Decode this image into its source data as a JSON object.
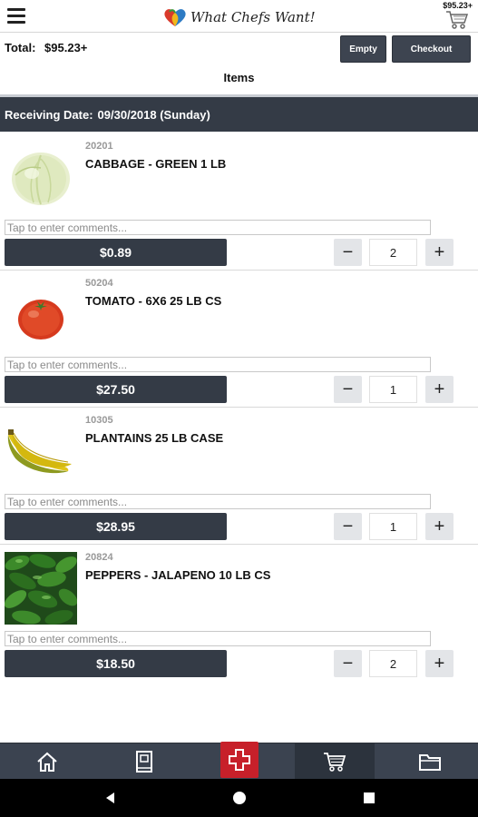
{
  "header": {
    "brand": "What Chefs Want!",
    "cart_amount": "$95.23+"
  },
  "summary": {
    "total_label": "Total:",
    "total_value": "$95.23+",
    "empty_label": "Empty",
    "checkout_label": "Checkout"
  },
  "section_title": "Items",
  "receiving": {
    "label": "Receiving Date:",
    "date": "09/30/2018 (Sunday)"
  },
  "comment_placeholder": "Tap to enter comments...",
  "items": [
    {
      "code": "20201",
      "name": "CABBAGE - GREEN 1 LB",
      "price": "$0.89",
      "qty": "2",
      "image": "cabbage-image"
    },
    {
      "code": "50204",
      "name": "TOMATO - 6X6 25 LB CS",
      "price": "$27.50",
      "qty": "1",
      "image": "tomato-image"
    },
    {
      "code": "10305",
      "name": "PLANTAINS 25 LB CASE",
      "price": "$28.95",
      "qty": "1",
      "image": "plantains-image"
    },
    {
      "code": "20824",
      "name": "PEPPERS - JALAPENO 10 LB CS",
      "price": "$18.50",
      "qty": "2",
      "image": "jalapeno-peppers-image"
    }
  ],
  "qty_controls": {
    "minus": "−",
    "plus": "+"
  },
  "nav": [
    {
      "name": "home",
      "icon": "home-icon"
    },
    {
      "name": "catalog",
      "icon": "book-icon"
    },
    {
      "name": "add",
      "icon": "plus-cross-icon"
    },
    {
      "name": "cart",
      "icon": "cart-icon",
      "active": true
    },
    {
      "name": "orders",
      "icon": "folder-icon"
    }
  ],
  "colors": {
    "dark": "#343b46",
    "accent_red": "#c7202a",
    "nav_bg": "#3b4350"
  }
}
